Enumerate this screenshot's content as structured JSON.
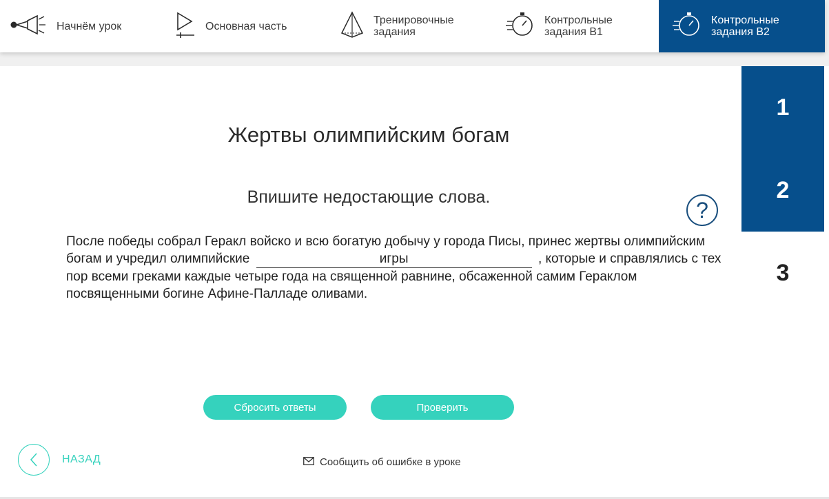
{
  "nav": {
    "items": [
      {
        "label": "Начнём урок",
        "icon": "megaphone-icon"
      },
      {
        "label": "Основная часть",
        "icon": "play-icon"
      },
      {
        "label": "Тренировочные задания",
        "icon": "pyramid-icon"
      },
      {
        "label": "Контрольные задания В1",
        "icon": "stopwatch-icon"
      },
      {
        "label": "Контрольные задания В2",
        "icon": "stopwatch-icon",
        "active": true
      }
    ],
    "active_color": "#064f8c"
  },
  "steps": [
    {
      "label": "1",
      "state": "done"
    },
    {
      "label": "2",
      "state": "done"
    },
    {
      "label": "3",
      "state": "current"
    }
  ],
  "task": {
    "title": "Жертвы олимпийским богам",
    "instruction": "Впишите недостающие слова.",
    "text_before": "После победы собрал Геракл войско и всю богатую добычу у города Писы, принес жертвы олимпийским богам и учредил олимпийские",
    "answer_value": "игры",
    "text_after": ", которые и справлялись с тех пор всеми греками каждые четыре года на священной равнине, обсаженной самим Гераклом посвященными богине Афине-Палладе оливами.",
    "help_glyph": "?"
  },
  "buttons": {
    "reset": "Сбросить ответы",
    "check": "Проверить",
    "accent_color": "#35d2bd"
  },
  "footer": {
    "back": "НАЗАД",
    "report": "Сообщить об ошибке в уроке"
  }
}
